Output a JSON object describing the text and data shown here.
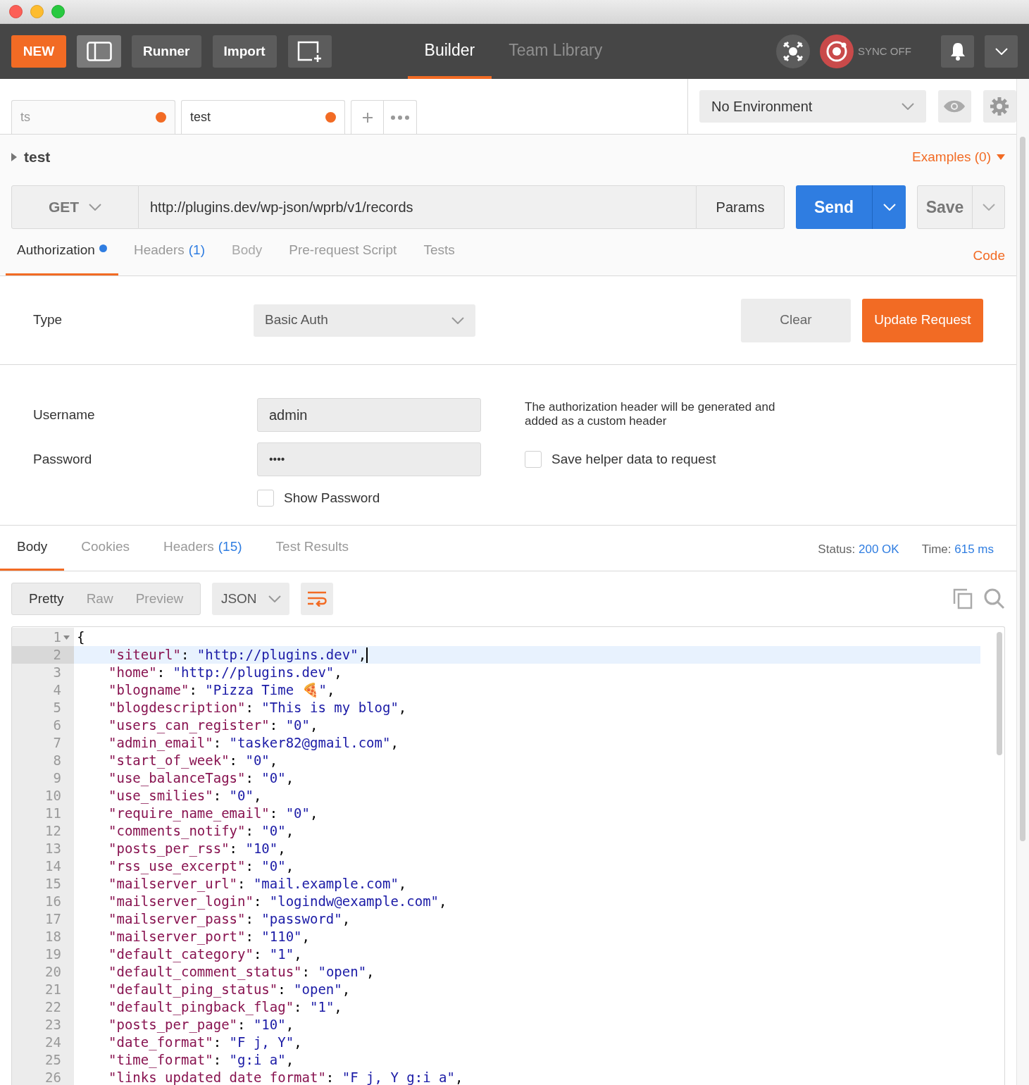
{
  "toolbar": {
    "new": "NEW",
    "runner": "Runner",
    "import": "Import",
    "views": [
      {
        "label": "Builder",
        "selected": true
      },
      {
        "label": "Team Library",
        "selected": false
      }
    ],
    "sync": "SYNC OFF"
  },
  "request_tabs": [
    {
      "label": "ts",
      "selected": false,
      "unsaved": true
    },
    {
      "label": "test",
      "selected": true,
      "unsaved": true
    }
  ],
  "environment": "No Environment",
  "request": {
    "name": "test",
    "examples": "Examples (0)",
    "method": "GET",
    "url": "http://plugins.dev/wp-json/wprb/v1/records",
    "params": "Params",
    "send": "Send",
    "save": "Save"
  },
  "request_sections": [
    {
      "label": "Authorization",
      "selected": true,
      "dot": true,
      "disabled": false
    },
    {
      "label": "Headers",
      "count": "(1)",
      "selected": false,
      "dot": false,
      "disabled": false
    },
    {
      "label": "Body",
      "selected": false,
      "dot": false,
      "disabled": true
    },
    {
      "label": "Pre-request Script",
      "selected": false,
      "dot": false,
      "disabled": false
    },
    {
      "label": "Tests",
      "selected": false,
      "dot": false,
      "disabled": false
    }
  ],
  "code_link": "Code",
  "auth": {
    "type_label": "Type",
    "type": "Basic Auth",
    "clear": "Clear",
    "update": "Update Request",
    "username_label": "Username",
    "username": "admin",
    "password_label": "Password",
    "password": "••••",
    "note": "The authorization header will be generated and added as a custom header",
    "save_helper": {
      "label": "Save helper data to request",
      "checked": false
    },
    "show_password": {
      "label": "Show Password",
      "checked": false
    }
  },
  "response_tabs": [
    {
      "label": "Body",
      "selected": true
    },
    {
      "label": "Cookies",
      "selected": false
    },
    {
      "label": "Headers",
      "count": "(15)",
      "selected": false
    },
    {
      "label": "Test Results",
      "selected": false
    }
  ],
  "status": {
    "label": "Status:",
    "value": "200 OK"
  },
  "time": {
    "label": "Time:",
    "value": "615 ms"
  },
  "view_modes": [
    {
      "label": "Pretty",
      "selected": true
    },
    {
      "label": "Raw",
      "selected": false
    },
    {
      "label": "Preview",
      "selected": false
    }
  ],
  "format": "JSON",
  "code_lines": [
    {
      "n": "1",
      "kind": "brace",
      "text": "{",
      "current": false
    },
    {
      "n": "2",
      "kind": "pair",
      "key": "\"siteurl\"",
      "sep": ": ",
      "value": "\"http://plugins.dev\"",
      "end": ",",
      "current": true
    },
    {
      "n": "3",
      "kind": "pair",
      "key": "\"home\"",
      "sep": ": ",
      "value": "\"http://plugins.dev\"",
      "end": ",",
      "current": false
    },
    {
      "n": "4",
      "kind": "pair",
      "key": "\"blogname\"",
      "sep": ": ",
      "value": "\"Pizza Time 🍕\"",
      "end": ",",
      "current": false
    },
    {
      "n": "5",
      "kind": "pair",
      "key": "\"blogdescription\"",
      "sep": ": ",
      "value": "\"This is my blog\"",
      "end": ",",
      "current": false
    },
    {
      "n": "6",
      "kind": "pair",
      "key": "\"users_can_register\"",
      "sep": ": ",
      "value": "\"0\"",
      "end": ",",
      "current": false
    },
    {
      "n": "7",
      "kind": "pair",
      "key": "\"admin_email\"",
      "sep": ": ",
      "value": "\"tasker82@gmail.com\"",
      "end": ",",
      "current": false
    },
    {
      "n": "8",
      "kind": "pair",
      "key": "\"start_of_week\"",
      "sep": ": ",
      "value": "\"0\"",
      "end": ",",
      "current": false
    },
    {
      "n": "9",
      "kind": "pair",
      "key": "\"use_balanceTags\"",
      "sep": ": ",
      "value": "\"0\"",
      "end": ",",
      "current": false
    },
    {
      "n": "10",
      "kind": "pair",
      "key": "\"use_smilies\"",
      "sep": ": ",
      "value": "\"0\"",
      "end": ",",
      "current": false
    },
    {
      "n": "11",
      "kind": "pair",
      "key": "\"require_name_email\"",
      "sep": ": ",
      "value": "\"0\"",
      "end": ",",
      "current": false
    },
    {
      "n": "12",
      "kind": "pair",
      "key": "\"comments_notify\"",
      "sep": ": ",
      "value": "\"0\"",
      "end": ",",
      "current": false
    },
    {
      "n": "13",
      "kind": "pair",
      "key": "\"posts_per_rss\"",
      "sep": ": ",
      "value": "\"10\"",
      "end": ",",
      "current": false
    },
    {
      "n": "14",
      "kind": "pair",
      "key": "\"rss_use_excerpt\"",
      "sep": ": ",
      "value": "\"0\"",
      "end": ",",
      "current": false
    },
    {
      "n": "15",
      "kind": "pair",
      "key": "\"mailserver_url\"",
      "sep": ": ",
      "value": "\"mail.example.com\"",
      "end": ",",
      "current": false
    },
    {
      "n": "16",
      "kind": "pair",
      "key": "\"mailserver_login\"",
      "sep": ": ",
      "value": "\"logindw@example.com\"",
      "end": ",",
      "current": false
    },
    {
      "n": "17",
      "kind": "pair",
      "key": "\"mailserver_pass\"",
      "sep": ": ",
      "value": "\"password\"",
      "end": ",",
      "current": false
    },
    {
      "n": "18",
      "kind": "pair",
      "key": "\"mailserver_port\"",
      "sep": ": ",
      "value": "\"110\"",
      "end": ",",
      "current": false
    },
    {
      "n": "19",
      "kind": "pair",
      "key": "\"default_category\"",
      "sep": ": ",
      "value": "\"1\"",
      "end": ",",
      "current": false
    },
    {
      "n": "20",
      "kind": "pair",
      "key": "\"default_comment_status\"",
      "sep": ": ",
      "value": "\"open\"",
      "end": ",",
      "current": false
    },
    {
      "n": "21",
      "kind": "pair",
      "key": "\"default_ping_status\"",
      "sep": ": ",
      "value": "\"open\"",
      "end": ",",
      "current": false
    },
    {
      "n": "22",
      "kind": "pair",
      "key": "\"default_pingback_flag\"",
      "sep": ": ",
      "value": "\"1\"",
      "end": ",",
      "current": false
    },
    {
      "n": "23",
      "kind": "pair",
      "key": "\"posts_per_page\"",
      "sep": ": ",
      "value": "\"10\"",
      "end": ",",
      "current": false
    },
    {
      "n": "24",
      "kind": "pair",
      "key": "\"date_format\"",
      "sep": ": ",
      "value": "\"F j, Y\"",
      "end": ",",
      "current": false
    },
    {
      "n": "25",
      "kind": "pair",
      "key": "\"time_format\"",
      "sep": ": ",
      "value": "\"g:i a\"",
      "end": ",",
      "current": false
    },
    {
      "n": "26",
      "kind": "pair",
      "key": "\"links_updated_date_format\"",
      "sep": ": ",
      "value": "\"F j, Y g:i a\"",
      "end": ",",
      "current": false
    }
  ]
}
